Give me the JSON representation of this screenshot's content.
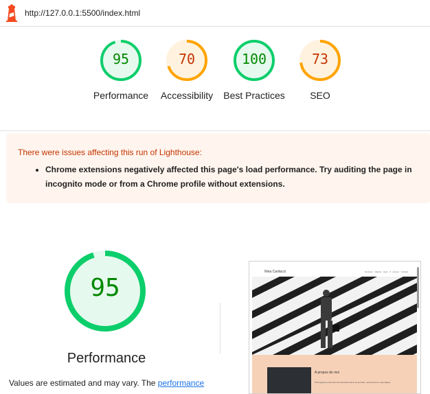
{
  "topbar": {
    "url": "http://127.0.0.1:5500/index.html",
    "logo_icon": "lighthouse-icon"
  },
  "gauges": [
    {
      "score": "95",
      "label": "Performance",
      "level": 0.95,
      "color": "#0cce6b",
      "text_color": "#008800",
      "fill": "#e6f9ee"
    },
    {
      "score": "70",
      "label": "Accessibility",
      "level": 0.7,
      "color": "#ffa400",
      "text_color": "#c33300",
      "fill": "#fff3e0"
    },
    {
      "score": "100",
      "label": "Best Practices",
      "level": 1.0,
      "color": "#0cce6b",
      "text_color": "#008800",
      "fill": "#e6f9ee"
    },
    {
      "score": "73",
      "label": "SEO",
      "level": 0.73,
      "color": "#ffa400",
      "text_color": "#c33300",
      "fill": "#fff3e0"
    }
  ],
  "warning": {
    "title": "There were issues affecting this run of Lighthouse:",
    "items": [
      "Chrome extensions negatively affected this page's load performance. Try auditing the page in incognito mode or from a Chrome profile without extensions."
    ]
  },
  "performance": {
    "score": "95",
    "level": 0.95,
    "title": "Performance",
    "desc_prefix": "Values are estimated and may vary. The ",
    "desc_link": "performance"
  },
  "screenshot": {
    "brand": "Nina Carducci",
    "links": "Services Galerie Quoi A propos Contact",
    "about_title": "A propos de moi",
    "about_text": "Photographe professionnel spécialisé dans les portraits, évènements et reportages."
  }
}
